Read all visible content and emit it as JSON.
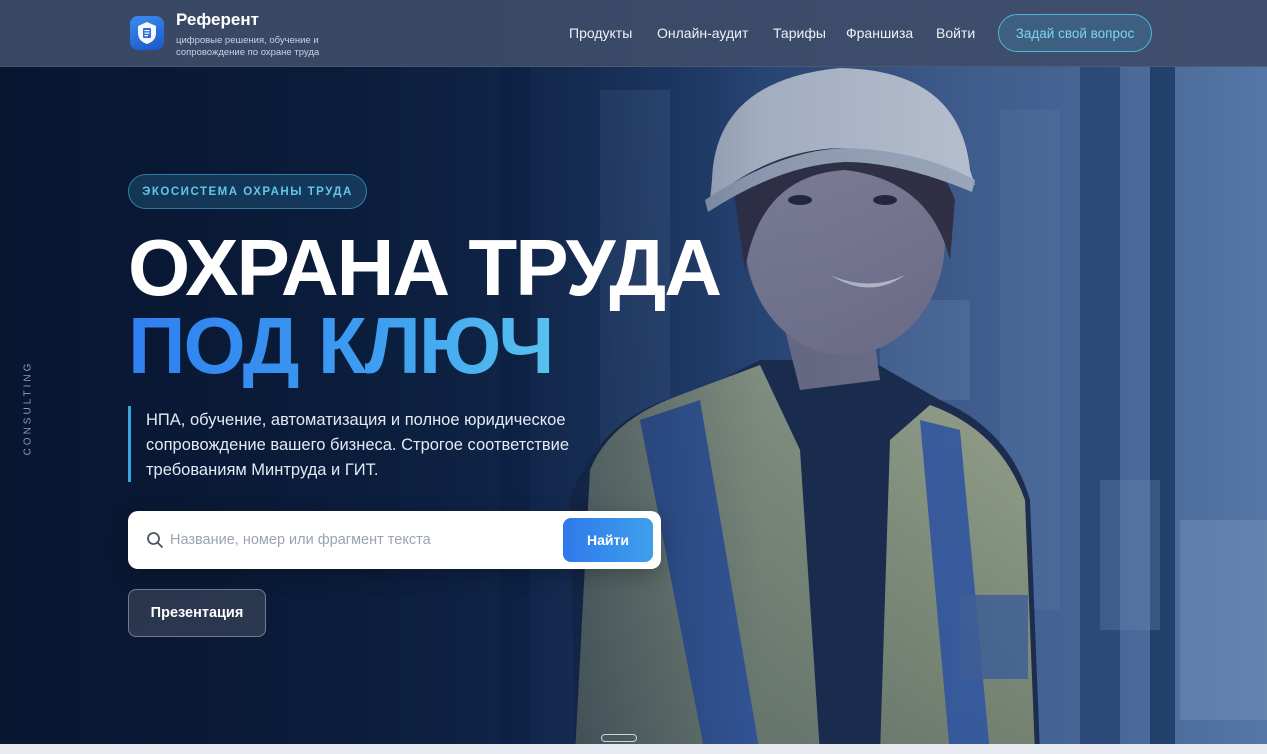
{
  "brand": {
    "name": "Референт",
    "tagline": "цифровые решения, обучение и сопровождение по охране труда",
    "logo_icon": "shield-document-icon"
  },
  "nav": {
    "items": [
      "Продукты",
      "Онлайн-аудит",
      "Тарифы",
      "Франшиза",
      "Войти"
    ],
    "cta_label": "Задай свой вопрос"
  },
  "side_label": "CONSULTING",
  "hero": {
    "eyebrow": "ЭКОСИСТЕМА ОХРАНЫ ТРУДА",
    "title_line1": "ОХРАНА ТРУДА",
    "title_line2": "ПОД КЛЮЧ",
    "description": "НПА, обучение, автоматизация и полное юридическое сопровождение вашего бизнеса. Строгое соответствие требованиям Минтруда и ГИТ."
  },
  "search": {
    "placeholder": "Название, номер или фрагмент текста",
    "value": "",
    "button_label": "Найти",
    "icon": "search-icon"
  },
  "presentation_label": "Презентация",
  "colors": {
    "accent_blue": "#2f7ff0",
    "accent_cyan": "#57c3ef",
    "header_bg": "#3e4c68"
  }
}
